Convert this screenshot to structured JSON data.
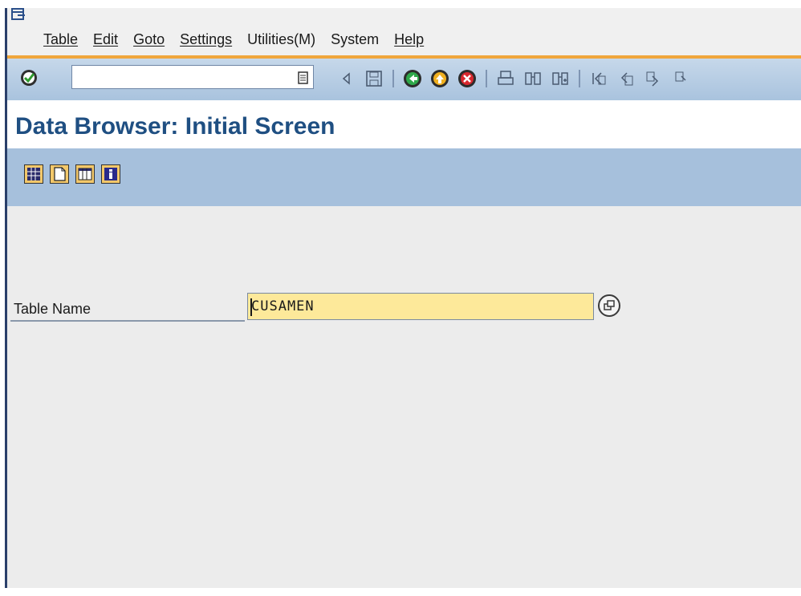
{
  "menubar": {
    "items": [
      "Table",
      "Edit",
      "Goto",
      "Settings",
      "Utilities(M)",
      "System",
      "Help"
    ]
  },
  "toolbar": {
    "command_field_value": "",
    "icons": [
      "enter-icon",
      "command-field-dropdown-icon",
      "back-arrow-icon",
      "save-icon",
      "back-icon",
      "exit-icon",
      "cancel-icon",
      "print-icon",
      "find-icon",
      "find-next-icon",
      "first-page-icon",
      "previous-page-icon",
      "next-page-icon",
      "last-page-icon"
    ]
  },
  "title": {
    "text": "Data Browser: Initial Screen"
  },
  "app_toolbar": {
    "icons": [
      "table-contents-icon",
      "create-entries-icon",
      "table-fields-icon",
      "info-icon"
    ]
  },
  "form": {
    "table_name_label": "Table Name",
    "table_name_value": "CUSAMEN"
  },
  "colors": {
    "title": "#1f4f82",
    "toolbar": "#a9c3de",
    "input_bg": "#fde99a",
    "accent_line": "#f0a63c"
  }
}
